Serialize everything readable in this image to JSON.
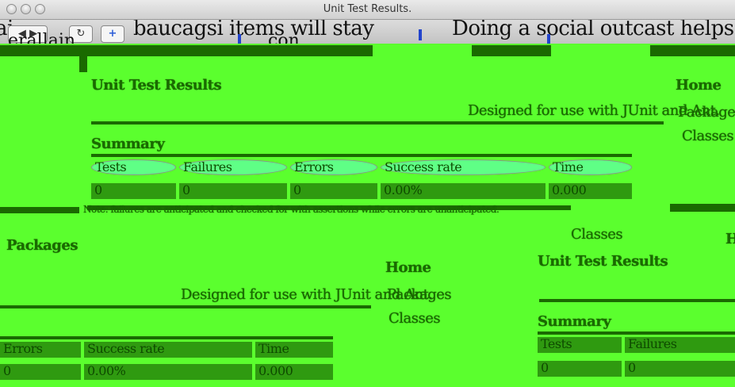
{
  "window": {
    "title": "Unit Test Results."
  },
  "toolbar": {
    "back": "◀",
    "forward": "▶",
    "reload": "↻",
    "add": "+",
    "garbled_line_1": "baucagsi items will stay",
    "garbled_line_2": "Doing a social outcast helps",
    "garbled_line_3": "erallain",
    "garbled_line_4": "con"
  },
  "report": {
    "heading": "Unit Test Results",
    "subheading": "Designed for use with JUnit and Ant.",
    "summary_heading": "Summary",
    "columns": [
      "Tests",
      "Failures",
      "Errors",
      "Success rate",
      "Time"
    ],
    "values": [
      "0",
      "0",
      "0",
      "0.00%",
      "0.000"
    ],
    "footer_note": "Note: failures are anticipated and checked for with assertions while errors are unanticipated.",
    "side_links": [
      "Home",
      "Packages",
      "Classes"
    ],
    "packages_label": "Packages",
    "classes_label": "Classes"
  }
}
